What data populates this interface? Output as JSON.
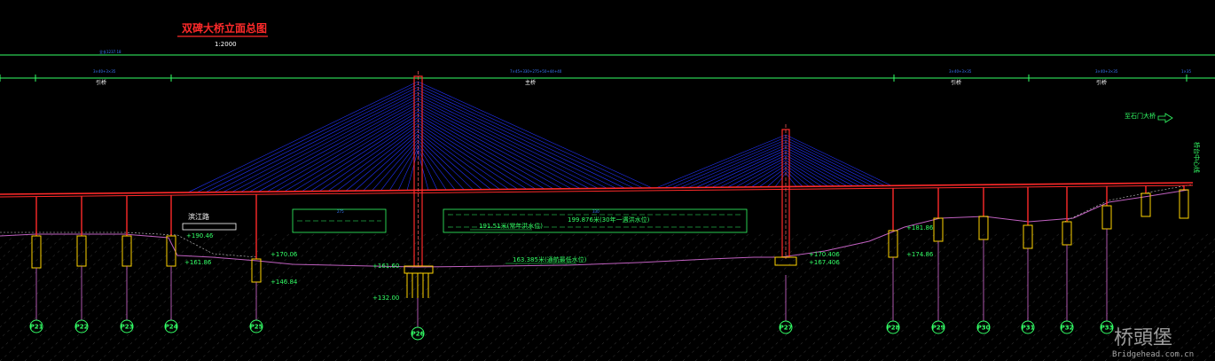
{
  "drawing": {
    "title": "双碑大桥立面总图",
    "scale": "1:2000",
    "total_length_label": "全长1237.18",
    "segments": [
      {
        "dim": "3×40+3×35",
        "label": "引桥"
      },
      {
        "dim": "7×45+330+275+50+44+40",
        "label": "主桥"
      },
      {
        "dim": "3×40+3×35",
        "label": "引桥"
      },
      {
        "dim": "3×40+3×35",
        "label": "引桥"
      },
      {
        "dim": "1×35",
        "label": ""
      }
    ],
    "road_label": "滨江路",
    "main_span_dim": "330",
    "side_span_dim": "275",
    "water_levels": [
      "199.876米(30年一遇洪水位)",
      "191.51米(常年洪水位)",
      "163.385米(通航最低水位)"
    ],
    "elevations": {
      "p24_top": "+190.46",
      "p24_bottom": "+161.86",
      "p25_top": "+170.06",
      "p25_bottom": "+146.84",
      "p26_top": "+161.60",
      "p26_bottom": "+132.00",
      "p27_top": "+170.406",
      "p27_bottom": "+167.406",
      "p28_top": "+181.86",
      "p28_bottom": "+174.86"
    },
    "direction_note": "至石门大桥",
    "abutment_note": "桥台中心线",
    "piers": [
      "P21",
      "P22",
      "P23",
      "P24",
      "P25",
      "P26",
      "P27",
      "P28",
      "P29",
      "P30",
      "P31",
      "P32",
      "P33"
    ]
  },
  "watermark": {
    "logo_text": "桥頭堡",
    "site": "Bridgehead.com.cn"
  }
}
